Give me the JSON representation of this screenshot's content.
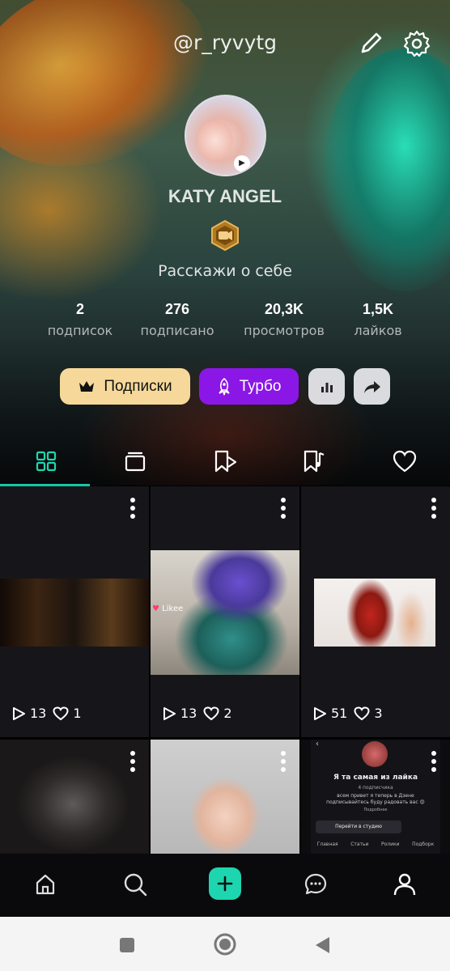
{
  "profile": {
    "username": "@r_ryvytg",
    "display_name": "KATY ANGEL",
    "bio": "Расскажи о себе"
  },
  "stats": [
    {
      "value": "2",
      "label": "подписок"
    },
    {
      "value": "276",
      "label": "подписано"
    },
    {
      "value": "20,3K",
      "label": "просмотров"
    },
    {
      "value": "1,5K",
      "label": "лайков"
    }
  ],
  "actions": {
    "subscriptions_label": "Подписки",
    "turbo_label": "Турбо"
  },
  "colors": {
    "accent": "#1dd6b0",
    "turbo": "#8a17e6",
    "subscriptions": "#f6d99a"
  },
  "tabs": [
    {
      "icon": "grid-icon",
      "active": true
    },
    {
      "icon": "collection-icon",
      "active": false
    },
    {
      "icon": "bookmark-play-icon",
      "active": false
    },
    {
      "icon": "bookmark-music-icon",
      "active": false
    },
    {
      "icon": "heart-icon",
      "active": false
    }
  ],
  "videos": [
    {
      "views": "13",
      "likes": "1"
    },
    {
      "views": "13",
      "likes": "2"
    },
    {
      "views": "51",
      "likes": "3"
    }
  ],
  "thumb_overlays": {
    "likee": "Likee",
    "zen_title": "Я та самая из лайка",
    "zen_subs": "4 подписчика",
    "zen_desc": "всем привет я теперь в Дзене подписывайтесь буду радовать вас 😍",
    "zen_source": "Подробнее",
    "zen_button": "Перейти в студию",
    "zen_tabs": [
      "Главная",
      "Статьи",
      "Ролики",
      "Подборк"
    ]
  },
  "bottom_nav": [
    "home-icon",
    "search-icon",
    "add-icon",
    "chat-icon",
    "profile-icon"
  ]
}
